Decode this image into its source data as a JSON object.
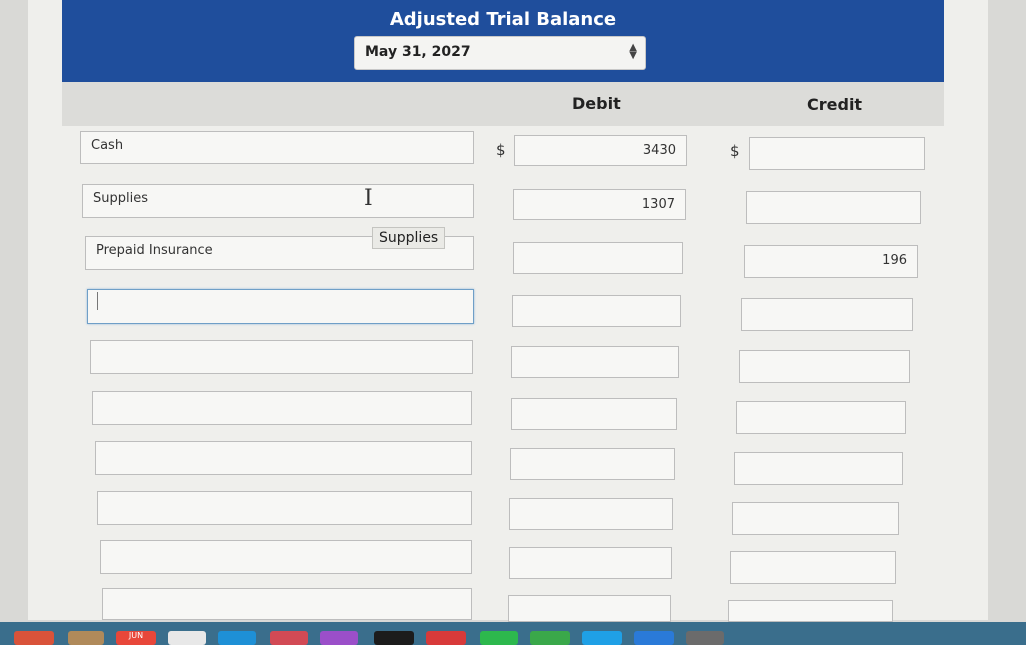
{
  "header": {
    "title": "Adjusted Trial Balance",
    "date": "May 31, 2027"
  },
  "columns": {
    "debit": "Debit",
    "credit": "Credit"
  },
  "currency_symbol": "$",
  "tooltip": "Supplies",
  "rows": [
    {
      "account": "Cash",
      "debit": "3430",
      "credit": ""
    },
    {
      "account": "Supplies",
      "debit": "1307",
      "credit": ""
    },
    {
      "account": "Prepaid Insurance",
      "debit": "",
      "credit": "196"
    },
    {
      "account": "",
      "debit": "",
      "credit": ""
    },
    {
      "account": "",
      "debit": "",
      "credit": ""
    },
    {
      "account": "",
      "debit": "",
      "credit": ""
    },
    {
      "account": "",
      "debit": "",
      "credit": ""
    },
    {
      "account": "",
      "debit": "",
      "credit": ""
    },
    {
      "account": "",
      "debit": "",
      "credit": ""
    },
    {
      "account": "",
      "debit": "",
      "credit": ""
    }
  ],
  "taskbar": {
    "calendar_month": "JUN"
  },
  "colors": {
    "header_bg": "#1f4e9c",
    "taskbar_bg": "#3a6e8c"
  }
}
